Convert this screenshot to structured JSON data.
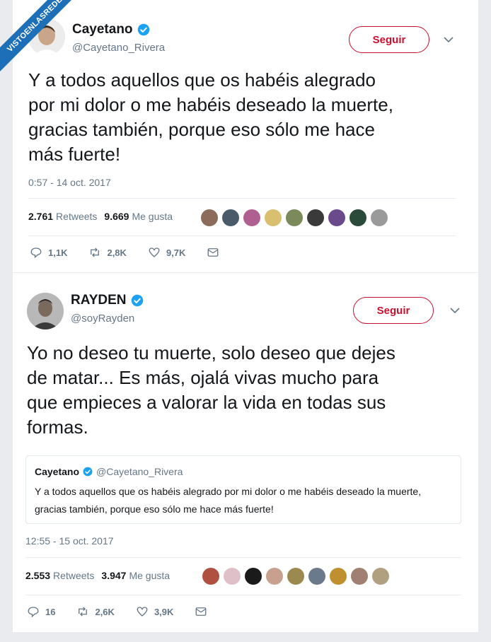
{
  "watermark": "VISTOENLASREDES",
  "tweet1": {
    "name": "Cayetano",
    "handle": "@Cayetano_Rivera",
    "follow_label": "Seguir",
    "text": "Y a todos aquellos que os habéis alegrado\npor mi dolor o me habéis deseado la muerte,\ngracias también, porque eso sólo me hace\nmás fuerte!",
    "timestamp": "0:57 - 14 oct. 2017",
    "retweets_count": "2.761",
    "retweets_label": "Retweets",
    "likes_count": "9.669",
    "likes_label": "Me gusta",
    "replies": "1,1K",
    "retweets_short": "2,8K",
    "likes_short": "9,7K"
  },
  "tweet2": {
    "name": "RAYDEN",
    "handle": "@soyRayden",
    "follow_label": "Seguir",
    "text": "Yo no deseo tu muerte, solo deseo que dejes\nde matar... Es más, ojalá vivas mucho para\nque empieces a valorar la vida en todas sus\nformas.",
    "quote": {
      "name": "Cayetano",
      "handle": "@Cayetano_Rivera",
      "text": "Y a todos aquellos que os habéis alegrado por mi dolor o me habéis deseado la muerte, gracias también, porque eso sólo me hace más fuerte!"
    },
    "timestamp": "12:55 - 15 oct. 2017",
    "retweets_count": "2.553",
    "retweets_label": "Retweets",
    "likes_count": "3.947",
    "likes_label": "Me gusta",
    "replies": "16",
    "retweets_short": "2,6K",
    "likes_short": "3,9K"
  },
  "colors": {
    "follow_red": "#c8102e",
    "verified_blue": "#1da1f2",
    "secondary_text": "#657786"
  }
}
